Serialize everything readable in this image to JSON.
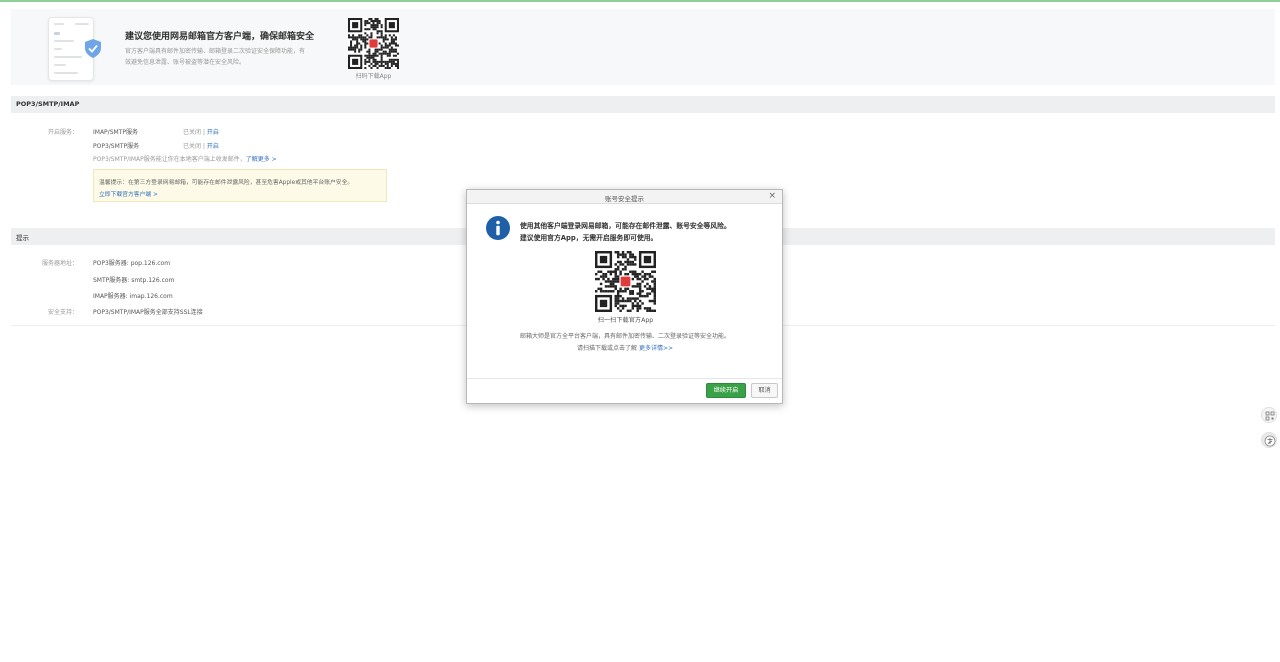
{
  "promo": {
    "title": "建议您使用网易邮箱官方客户端，确保邮箱安全",
    "desc": "官方客户端具有邮件加密传输、邮箱登录二次验证安全保障功能，有效避免信息泄露、账号被盗等潜在安全风险。",
    "qr_label": "扫码下载App"
  },
  "pop_section": {
    "header": "POP3/SMTP/IMAP",
    "enable_label": "开启服务：",
    "services": [
      {
        "name": "IMAP/SMTP服务",
        "status": "已关闭",
        "action": "开启"
      },
      {
        "name": "POP3/SMTP服务",
        "status": "已关闭",
        "action": "开启"
      }
    ],
    "sep": "|",
    "note": "POP3/SMTP/IMAP服务能让你在本地客户端上收发邮件，",
    "learn_more": "了解更多 >",
    "tip_text": "温馨提示：在第三方登录网易邮箱，可能存在邮件泄露风险，甚至危害Apple或其他平台账户安全。",
    "tip_link": "立即下载官方客户端 >"
  },
  "tips_section": {
    "header": "提示",
    "server_label": "服务器地址：",
    "servers": [
      "POP3服务器: pop.126.com",
      "SMTP服务器: smtp.126.com",
      "IMAP服务器: imap.126.com"
    ],
    "security_label": "安全支持：",
    "security_text": "POP3/SMTP/IMAP服务全部支持SSL连接"
  },
  "modal": {
    "title": "账号安全提示",
    "close": "×",
    "msg_line1": "使用其他客户端登录网易邮箱，可能存在邮件泄露、账号安全等风险。",
    "msg_line2": "建议使用官方App，无需开启服务即可使用。",
    "qr_label": "扫一扫下载官方App",
    "desc_text": "邮箱大师是官方全平台客户端，具有邮件加密传输、二次登录验证等安全功能。请扫描下载或点击了解",
    "desc_link": "更多详情>>",
    "ok_label": "继续开启",
    "cancel_label": "取消"
  },
  "colors": {
    "accent_green": "#3aa148",
    "link_blue": "#2f6fbf",
    "info_blue": "#1f5fa8",
    "brand_red": "#e03a3a"
  },
  "icons": [
    "shield-icon",
    "info-icon",
    "close-icon",
    "qr-code",
    "scan-icon",
    "translate-icon"
  ]
}
